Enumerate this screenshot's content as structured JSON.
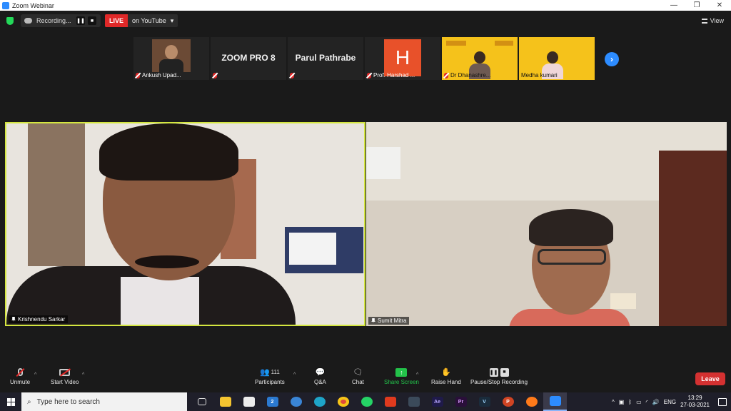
{
  "window": {
    "title": "Zoom Webinar",
    "controls": [
      "—",
      "❐",
      "✕"
    ]
  },
  "topbar": {
    "recording_label": "Recording...",
    "live_label": "LIVE",
    "stream_label": "on YouTube",
    "stream_caret": "▾",
    "view_label": "View"
  },
  "thumbnails": [
    {
      "name": "Ankush Upad...",
      "kind": "photo"
    },
    {
      "name": "",
      "kind": "text",
      "text": "ZOOM PRO 8"
    },
    {
      "name": "",
      "kind": "text",
      "text": "Parul Pathrabe"
    },
    {
      "name": "Prof. Harshad ...",
      "kind": "letter",
      "letter": "H"
    },
    {
      "name": "Dr Dhanashre...",
      "kind": "yellow"
    },
    {
      "name": "Medha kumari",
      "kind": "yellow"
    }
  ],
  "next_arrow": "›",
  "videos": {
    "left": {
      "name": "Krishnendu Sarkar"
    },
    "right": {
      "name": "Sumit Mitra"
    }
  },
  "toolbar": {
    "unmute": "Unmute",
    "start_video": "Start Video",
    "participants": "Participants",
    "participants_count": "111",
    "qa": "Q&A",
    "chat": "Chat",
    "share_screen": "Share Screen",
    "raise_hand": "Raise Hand",
    "pause_stop_recording": "Pause/Stop Recording",
    "leave": "Leave",
    "caret": "^"
  },
  "taskbar": {
    "search_placeholder": "Type here to search",
    "mail_badge": "2",
    "app_labels": {
      "ae": "Ae",
      "pr": "Pr",
      "v": "V",
      "p": "P"
    },
    "language": "ENG",
    "time": "13:29",
    "date": "27-03-2021"
  },
  "colors": {
    "accent": "#2d8cff",
    "live": "#e02828",
    "share": "#23c24a",
    "active_speaker_border": "#d4e640",
    "leave": "#d43131"
  }
}
